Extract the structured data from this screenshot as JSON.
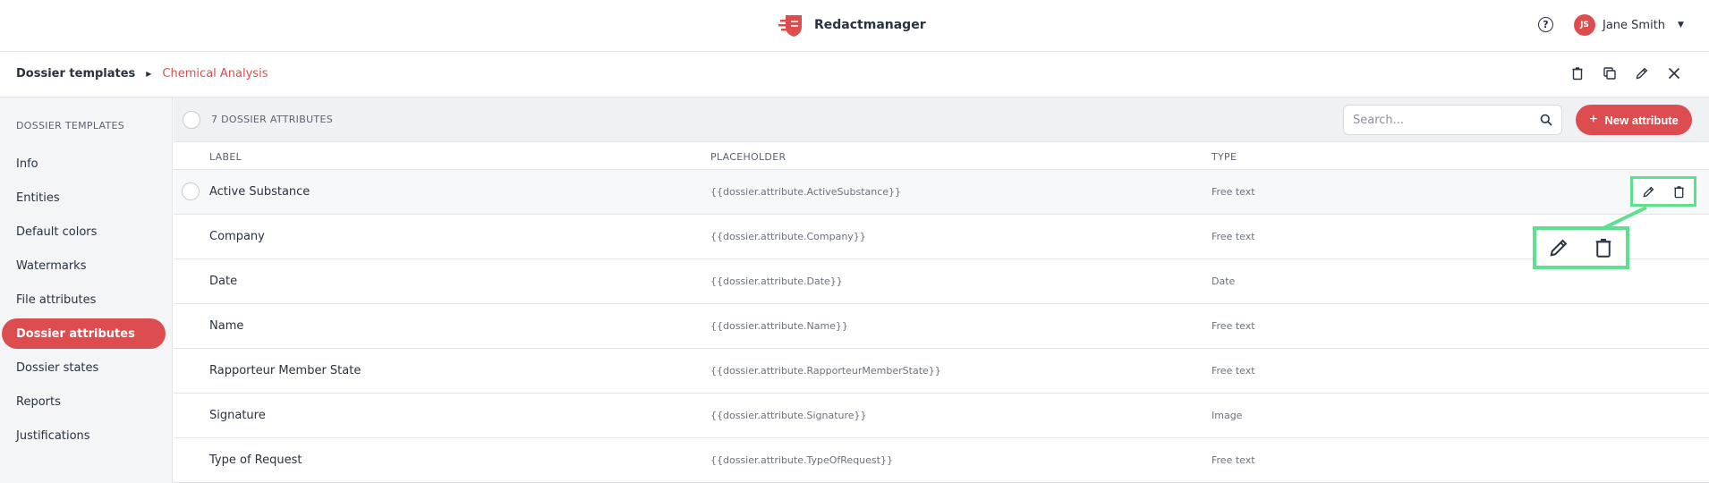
{
  "header": {
    "app_name": "Redactmanager",
    "help_icon": "help-circle-icon",
    "help_glyph": "?",
    "user": {
      "initials": "JS",
      "name": "Jane Smith"
    }
  },
  "breadcrumb": {
    "parent": "Dossier templates",
    "current": "Chemical Analysis",
    "actions": [
      "trash-icon",
      "duplicate-icon",
      "pencil-icon",
      "close-icon"
    ]
  },
  "sidebar": {
    "title": "DOSSIER TEMPLATES",
    "items": [
      {
        "label": "Info",
        "active": false
      },
      {
        "label": "Entities",
        "active": false
      },
      {
        "label": "Default colors",
        "active": false
      },
      {
        "label": "Watermarks",
        "active": false
      },
      {
        "label": "File attributes",
        "active": false
      },
      {
        "label": "Dossier attributes",
        "active": true
      },
      {
        "label": "Dossier states",
        "active": false
      },
      {
        "label": "Reports",
        "active": false
      },
      {
        "label": "Justifications",
        "active": false
      }
    ]
  },
  "toolbar": {
    "count_label": "7 DOSSIER ATTRIBUTES",
    "search_placeholder": "Search...",
    "new_button_label": "New attribute",
    "new_button_plus": "+"
  },
  "table": {
    "columns": {
      "label": "LABEL",
      "placeholder": "PLACEHOLDER",
      "type": "TYPE"
    },
    "rows": [
      {
        "label": "Active Substance",
        "placeholder": "{{dossier.attribute.ActiveSubstance}}",
        "type": "Free text"
      },
      {
        "label": "Company",
        "placeholder": "{{dossier.attribute.Company}}",
        "type": "Free text"
      },
      {
        "label": "Date",
        "placeholder": "{{dossier.attribute.Date}}",
        "type": "Date"
      },
      {
        "label": "Name",
        "placeholder": "{{dossier.attribute.Name}}",
        "type": "Free text"
      },
      {
        "label": "Rapporteur Member State",
        "placeholder": "{{dossier.attribute.RapporteurMemberState}}",
        "type": "Free text"
      },
      {
        "label": "Signature",
        "placeholder": "{{dossier.attribute.Signature}}",
        "type": "Image"
      },
      {
        "label": "Type of Request",
        "placeholder": "{{dossier.attribute.TypeOfRequest}}",
        "type": "Free text"
      }
    ]
  },
  "colors": {
    "accent": "#dd4d50",
    "highlight": "#5ee08f",
    "text": "#283241"
  }
}
